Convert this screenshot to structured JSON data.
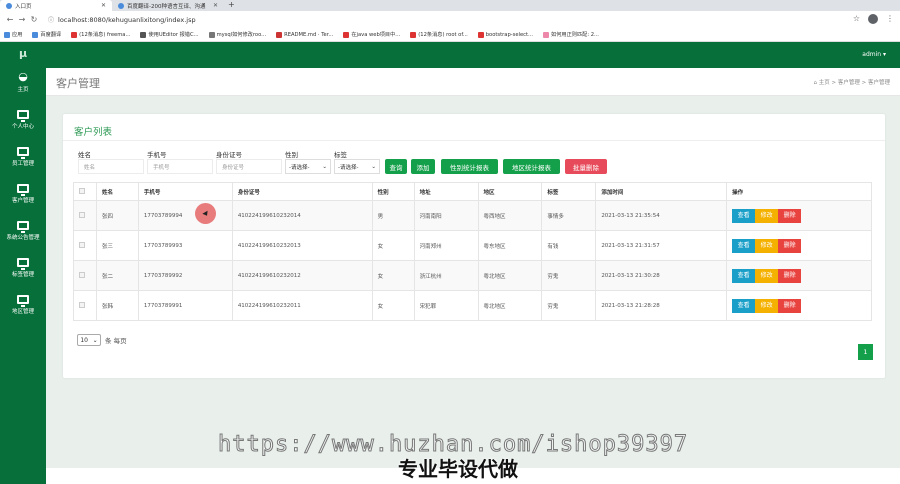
{
  "browser": {
    "tabs": [
      {
        "label": "入口页"
      },
      {
        "label": "百度翻译-200种语言互译、沟通"
      }
    ],
    "url": "localhost:8080/kehuguanlixitong/index.jsp",
    "bookmarks": [
      "应用",
      "百度翻译",
      "(12条消息) freema...",
      "使用UEditor 报错C...",
      "mysql如何修改roo...",
      "README.md · Ter...",
      "在java web项目中...",
      "(12条消息) root of...",
      "bootstrap-select...",
      "如何用正则匹配: 2..."
    ]
  },
  "sidebar": {
    "logo": "μ",
    "items": [
      {
        "label": "主页"
      },
      {
        "label": "个人中心"
      },
      {
        "label": "员工管理"
      },
      {
        "label": "客户管理"
      },
      {
        "label": "系统公告管理"
      },
      {
        "label": "标签管理"
      },
      {
        "label": "地区管理"
      }
    ]
  },
  "topbar": {
    "user": "admin ▾"
  },
  "page": {
    "title": "客户管理",
    "breadcrumb": "⌂ 主页  >  客户管理  >  客户管理"
  },
  "card": {
    "title": "客户列表"
  },
  "filters": {
    "name_label": "姓名",
    "name_placeholder": "姓名",
    "phone_label": "手机号",
    "phone_placeholder": "手机号",
    "id_label": "身份证号",
    "id_placeholder": "身份证号",
    "gender_label": "性别",
    "gender_value": "-请选择-",
    "tag_label": "标签",
    "tag_value": "-请选择-"
  },
  "buttons": {
    "query": "查询",
    "add": "添加",
    "gender_report": "性别统计报表",
    "region_report": "地区统计报表",
    "batch_delete": "批量删除"
  },
  "table": {
    "headers": [
      "姓名",
      "手机号",
      "身份证号",
      "性别",
      "地址",
      "地区",
      "标签",
      "添加时间",
      "操作"
    ],
    "rows": [
      [
        "张四",
        "17703789994",
        "410224199610232014",
        "男",
        "河南南阳",
        "粤西地区",
        "事情多",
        "2021-03-13 21:35:54"
      ],
      [
        "张三",
        "17703789993",
        "410224199610232013",
        "女",
        "河南郑州",
        "粤东地区",
        "有钱",
        "2021-03-13 21:31:57"
      ],
      [
        "张二",
        "17703789992",
        "410224199610232012",
        "女",
        "浙江杭州",
        "粤北地区",
        "穷鬼",
        "2021-03-13 21:30:28"
      ],
      [
        "张韩",
        "17703789991",
        "410224199610232011",
        "女",
        "宋犯罪",
        "粤北地区",
        "穷鬼",
        "2021-03-13 21:28:28"
      ]
    ],
    "actions": {
      "view": "查看",
      "edit": "修改",
      "delete": "删除"
    }
  },
  "pagination": {
    "page_size": "10",
    "per_page_label": "条 每页",
    "current": "1"
  },
  "overlay": {
    "watermark": "https://www.huzhan.com/ishop39397",
    "slogan": "专业毕设代做"
  }
}
